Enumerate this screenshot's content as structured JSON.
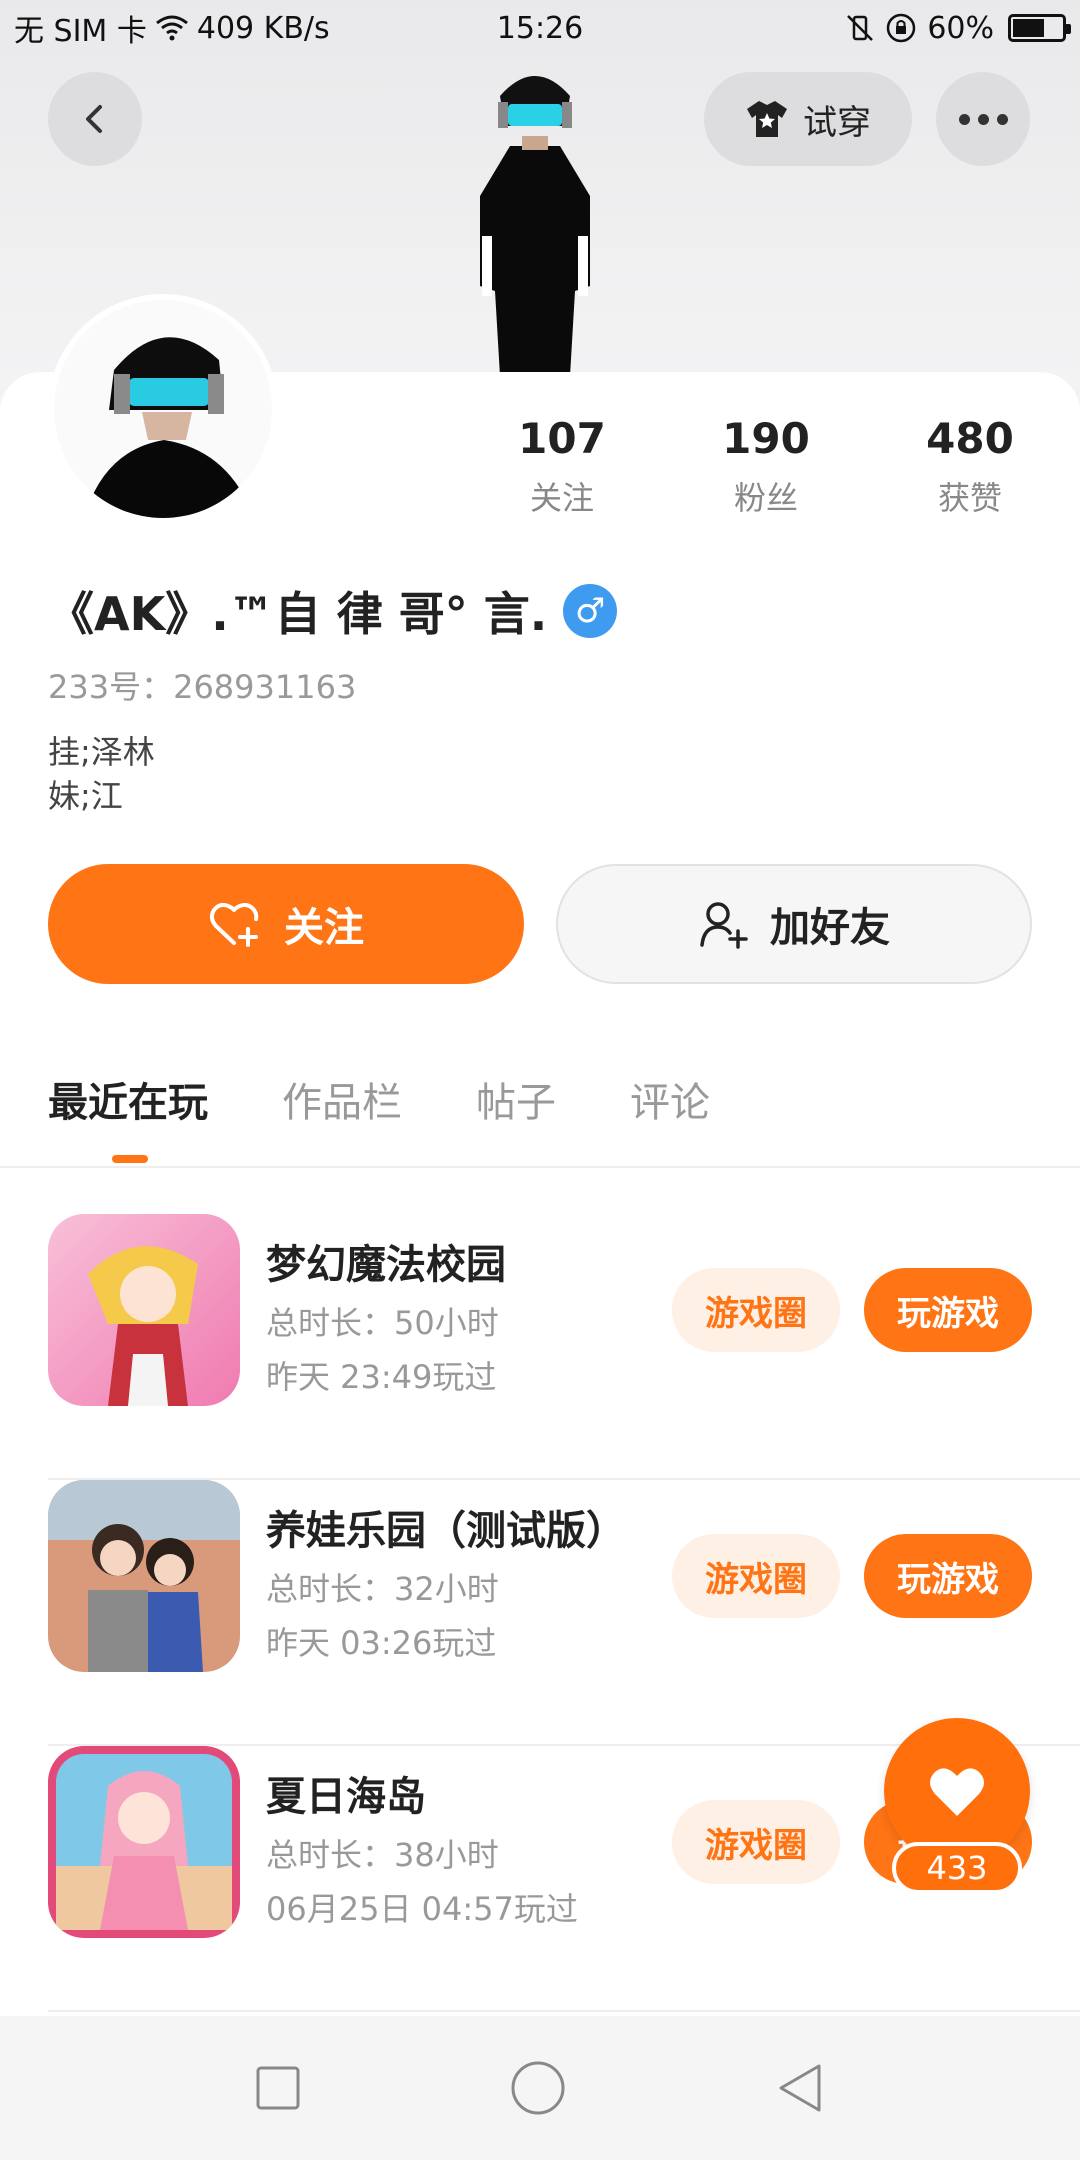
{
  "status_bar": {
    "carrier": "无 SIM 卡",
    "speed": "409 KB/s",
    "time": "15:26",
    "battery": "60%",
    "battery_level": 0.6
  },
  "header": {
    "try_on_label": "试穿"
  },
  "profile": {
    "nickname": "《AK》.™自 律 哥° 言.",
    "gender_symbol": "♂",
    "id_text": "233号：268931163",
    "bio_lines": [
      "挂;泽林",
      "妹;江"
    ]
  },
  "stats": [
    {
      "value": "107",
      "label": "关注"
    },
    {
      "value": "190",
      "label": "粉丝"
    },
    {
      "value": "480",
      "label": "获赞"
    }
  ],
  "actions": {
    "follow_label": "关注",
    "add_friend_label": "加好友"
  },
  "tabs": [
    {
      "label": "最近在玩",
      "active": true
    },
    {
      "label": "作品栏",
      "active": false
    },
    {
      "label": "帖子",
      "active": false
    },
    {
      "label": "评论",
      "active": false
    }
  ],
  "games": [
    {
      "name": "梦幻魔法校园",
      "duration": "总时长：50小时",
      "last_played": "昨天 23:49玩过",
      "circle_label": "游戏圈",
      "play_label": "玩游戏"
    },
    {
      "name": "养娃乐园（测试版）",
      "duration": "总时长：32小时",
      "last_played": "昨天 03:26玩过",
      "circle_label": "游戏圈",
      "play_label": "玩游戏"
    },
    {
      "name": "夏日海岛",
      "duration": "总时长：38小时",
      "last_played": "06月25日 04:57玩过",
      "circle_label": "游戏圈",
      "play_label": "玩游戏"
    }
  ],
  "like_fab": {
    "count": "433"
  },
  "colors": {
    "accent": "#ff7415",
    "accent_light": "#fff0e5",
    "gender_blue": "#3e9bf0"
  }
}
